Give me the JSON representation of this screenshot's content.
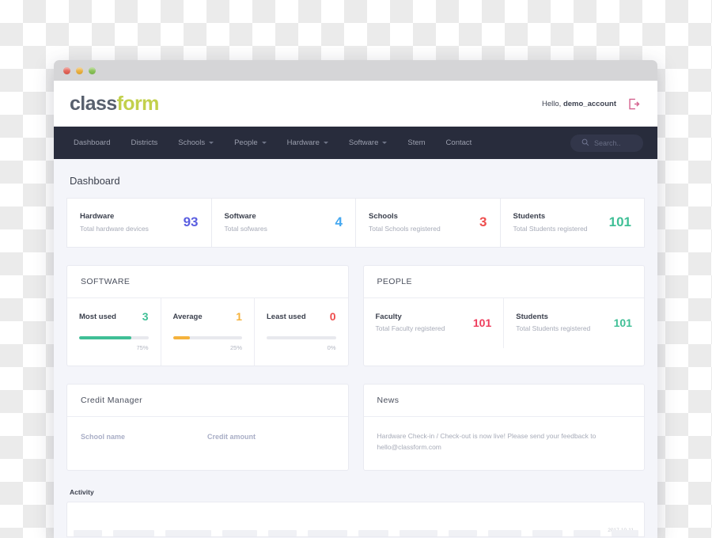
{
  "window": {
    "traffic_lights": [
      "close",
      "minimize",
      "maximize"
    ]
  },
  "header": {
    "logo_part1": "class",
    "logo_part2": "form",
    "greeting_prefix": "Hello,",
    "account_name": "demo_account",
    "logout_icon": "logout-icon",
    "logout_color": "#d4618e"
  },
  "nav": {
    "items": [
      {
        "label": "Dashboard",
        "has_caret": false
      },
      {
        "label": "Districts",
        "has_caret": false
      },
      {
        "label": "Schools",
        "has_caret": true
      },
      {
        "label": "People",
        "has_caret": true
      },
      {
        "label": "Hardware",
        "has_caret": true
      },
      {
        "label": "Software",
        "has_caret": true
      },
      {
        "label": "Stem",
        "has_caret": false
      },
      {
        "label": "Contact",
        "has_caret": false
      }
    ],
    "search": {
      "icon": "search-icon",
      "placeholder": "Search.."
    }
  },
  "page": {
    "title": "Dashboard"
  },
  "stats": [
    {
      "label": "Hardware",
      "sub": "Total hardware devices",
      "value": "93",
      "color": "#5a5ee0"
    },
    {
      "label": "Software",
      "sub": "Total sofwares",
      "value": "4",
      "color": "#45a8f0"
    },
    {
      "label": "Schools",
      "sub": "Total Schools registered",
      "value": "3",
      "color": "#ee4d4d"
    },
    {
      "label": "Students",
      "sub": "Total Students registered",
      "value": "101",
      "color": "#3fbf96"
    }
  ],
  "software_panel": {
    "title": "SOFTWARE",
    "items": [
      {
        "label": "Most used",
        "value": "3",
        "color": "#3fbf96",
        "percent": "75%",
        "pct_num": 75
      },
      {
        "label": "Average",
        "value": "1",
        "color": "#f5b23c",
        "percent": "25%",
        "pct_num": 25
      },
      {
        "label": "Least used",
        "value": "0",
        "color": "#ee4d4d",
        "percent": "0%",
        "pct_num": 0
      }
    ]
  },
  "people_panel": {
    "title": "PEOPLE",
    "items": [
      {
        "label": "Faculty",
        "sub": "Total Faculty registered",
        "value": "101",
        "color": "#ee3d5c"
      },
      {
        "label": "Students",
        "sub": "Total Students registered",
        "value": "101",
        "color": "#3fbf96"
      }
    ]
  },
  "credit_manager": {
    "title": "Credit Manager",
    "columns": [
      "School name",
      "Credit amount"
    ]
  },
  "news": {
    "title": "News",
    "body": "Hardware Check-in / Check-out is now live! Please send your feedback to hello@classform.com"
  },
  "activity": {
    "label": "Activity",
    "date": "2017-10-11"
  }
}
